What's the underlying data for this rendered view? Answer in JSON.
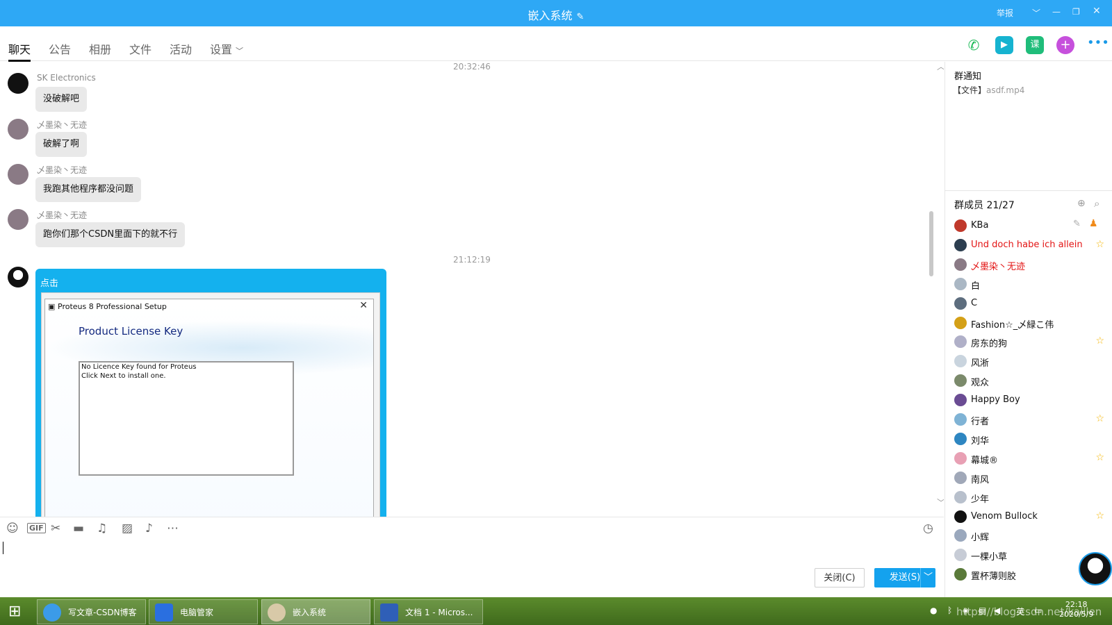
{
  "window": {
    "title": "嵌入系统",
    "report_label": "举报"
  },
  "tabs": [
    "聊天",
    "公告",
    "相册",
    "文件",
    "活动",
    "设置"
  ],
  "header_icons": [
    "phone-icon",
    "video-call-icon",
    "lesson-icon",
    "add-app-icon",
    "more-icon"
  ],
  "header_lesson_label": "课",
  "chat": {
    "timestamps": [
      "20:32:46",
      "21:12:19"
    ],
    "messages": [
      {
        "sender": "SK  Electronics",
        "text": "没破解吧"
      },
      {
        "sender": "乄墨染丶无迹",
        "text": "破解了啊"
      },
      {
        "sender": "乄墨染丶无迹",
        "text": "我跑其他程序都没问题"
      },
      {
        "sender": "乄墨染丶无迹",
        "text": "跑你们那个CSDN里面下的就不行"
      }
    ],
    "image_message": {
      "label": "点击",
      "dialog_title": "Proteus 8 Professional Setup",
      "dialog_heading": "Product License Key",
      "dialog_line1": "No Licence Key found for Proteus",
      "dialog_line2": "Click Next to install one."
    }
  },
  "toolbar_icons": [
    "emoji-icon",
    "gif-icon",
    "scissors-icon",
    "folder-icon",
    "music-icon",
    "image-icon",
    "bell-icon",
    "more-icon",
    "history-icon"
  ],
  "toolbar_gif_label": "GIF",
  "buttons": {
    "close": "关闭(C)",
    "send": "发送(S)"
  },
  "sidebar": {
    "notice_title": "群通知",
    "notice_tag": "【文件】",
    "notice_file": "asdf.mp4",
    "members_title": "群成员 21/27",
    "members": [
      {
        "name": "KBa",
        "red": false,
        "star": false
      },
      {
        "name": "Und doch habe ich allein",
        "red": true,
        "star": true
      },
      {
        "name": "乄墨染丶无迹",
        "red": true,
        "star": false
      },
      {
        "name": "白",
        "red": false,
        "star": false
      },
      {
        "name": "C",
        "red": false,
        "star": false
      },
      {
        "name": "Fashion☆_乄緑こ伟",
        "red": false,
        "star": false
      },
      {
        "name": "房东的狗",
        "red": false,
        "star": true
      },
      {
        "name": "风淅",
        "red": false,
        "star": false
      },
      {
        "name": "观众",
        "red": false,
        "star": false
      },
      {
        "name": "Happy Boy",
        "red": false,
        "star": false
      },
      {
        "name": "行者",
        "red": false,
        "star": true
      },
      {
        "name": "刘华",
        "red": false,
        "star": false
      },
      {
        "name": "幕城®",
        "red": false,
        "star": true
      },
      {
        "name": "南风",
        "red": false,
        "star": false
      },
      {
        "name": "少年",
        "red": false,
        "star": false
      },
      {
        "name": "Venom Bullock",
        "red": false,
        "star": true
      },
      {
        "name": "小辉",
        "red": false,
        "star": false
      },
      {
        "name": "一棵小草",
        "red": false,
        "star": false
      },
      {
        "name": "置杯薄则胶",
        "red": false,
        "star": false
      }
    ]
  },
  "taskbar": {
    "items": [
      "写文章-CSDN博客",
      "电脑管家",
      "嵌入系统",
      "文档 1 - Micros..."
    ],
    "ime_label": "英",
    "watermark": "https://blog.csdn.net/kaiilen",
    "time": "22:18",
    "date": "2020/5/9"
  },
  "colors": {
    "accent": "#2ea8f5",
    "image_bubble": "#14b1ee",
    "send_button": "#14a2ee",
    "admin_red": "#e31414",
    "star": "#f4b400"
  }
}
